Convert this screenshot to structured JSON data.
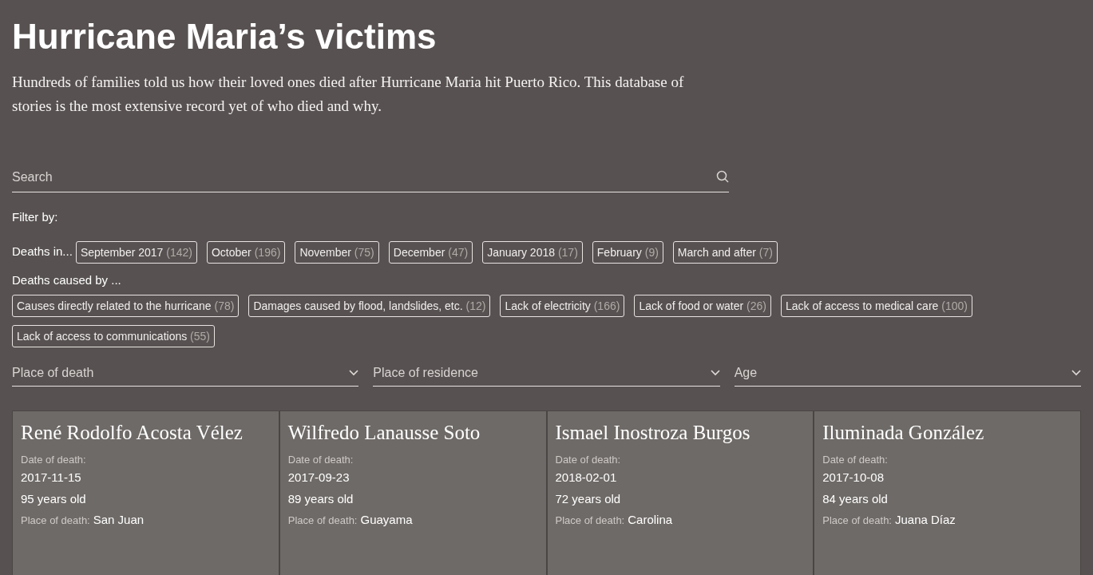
{
  "title": "Hurricane Maria’s victims",
  "intro": "Hundreds of families told us how their loved ones died after Hurricane Maria hit Puerto Rico. This database of stories is the most extensive record yet of who died and why.",
  "search": {
    "placeholder": "Search"
  },
  "filter_label": "Filter by:",
  "month_filter": {
    "label": "Deaths in...",
    "options": [
      {
        "label": "September 2017",
        "count": "(142)",
        "selected": false
      },
      {
        "label": "October",
        "count": "(196)",
        "selected": false
      },
      {
        "label": "November",
        "count": "(75)",
        "selected": false
      },
      {
        "label": "December",
        "count": "(47)",
        "selected": false
      },
      {
        "label": "January 2018",
        "count": "(17)",
        "selected": false
      },
      {
        "label": "February",
        "count": "(9)",
        "selected": false
      },
      {
        "label": "March and after",
        "count": "(7)",
        "selected": false
      }
    ]
  },
  "cause_filter": {
    "label": "Deaths caused by ...",
    "options": [
      {
        "label": "Causes directly related to the hurricane",
        "count": "(78)",
        "selected": false
      },
      {
        "label": "Damages caused by flood, landslides, etc.",
        "count": "(12)",
        "selected": false
      },
      {
        "label": "Lack of electricity",
        "count": "(166)",
        "selected": false
      },
      {
        "label": "Lack of food or water",
        "count": "(26)",
        "selected": false
      },
      {
        "label": "Lack of access to medical care",
        "count": "(100)",
        "selected": false
      },
      {
        "label": "Lack of access to communications",
        "count": "(55)",
        "selected": false
      }
    ]
  },
  "dropdowns": [
    "Place of death",
    "Place of residence",
    "Age"
  ],
  "victims": [
    {
      "name": "René Rodolfo Acosta Vélez",
      "date_label": "Date of death:",
      "date": "2017-11-15",
      "age": "95 years old",
      "place_label": "Place of death:",
      "place": "San Juan"
    },
    {
      "name": "Wilfredo Lanausse Soto",
      "date_label": "Date of death:",
      "date": "2017-09-23",
      "age": "89 years old",
      "place_label": "Place of death:",
      "place": "Guayama"
    },
    {
      "name": "Ismael Inostroza Burgos",
      "date_label": "Date of death:",
      "date": "2018-02-01",
      "age": "72 years old",
      "place_label": "Place of death:",
      "place": "Carolina"
    },
    {
      "name": "Iluminada González",
      "date_label": "Date of death:",
      "date": "2017-10-08",
      "age": "84 years old",
      "place_label": "Place of death:",
      "place": "Juana Díaz"
    }
  ]
}
